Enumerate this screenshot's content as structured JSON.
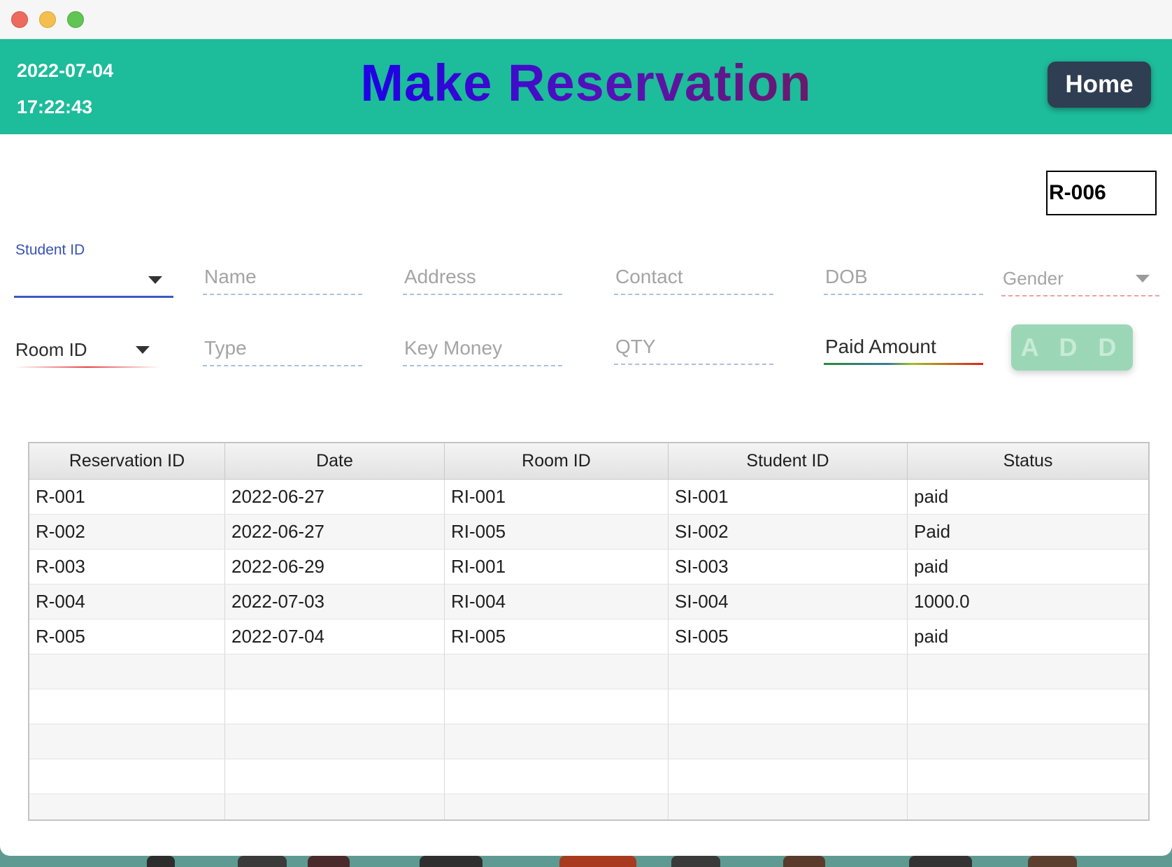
{
  "header": {
    "date": "2022-07-04",
    "time": "17:22:43",
    "title": "Make Reservation",
    "home_label": "Home",
    "colors": {
      "bar": "#1dbc9b",
      "title_start": "#1e00e6",
      "title_end": "#6a1a6a",
      "home_button": "#2f3e52"
    }
  },
  "reservation_id": "R-006",
  "form": {
    "student_id": {
      "label": "Student ID",
      "value": ""
    },
    "name": {
      "placeholder": "Name"
    },
    "address": {
      "placeholder": "Address"
    },
    "contact": {
      "placeholder": "Contact"
    },
    "dob": {
      "placeholder": "DOB"
    },
    "gender": {
      "placeholder": "Gender"
    },
    "room_id": {
      "placeholder": "Room ID"
    },
    "type": {
      "placeholder": "Type"
    },
    "key_money": {
      "placeholder": "Key Money"
    },
    "qty": {
      "placeholder": "QTY"
    },
    "paid_amount": {
      "placeholder": "Paid Amount"
    },
    "add_label": "A D D"
  },
  "table": {
    "columns": [
      "Reservation ID",
      "Date",
      "Room ID",
      "Student ID",
      "Status"
    ],
    "rows": [
      [
        "R-001",
        "2022-06-27",
        "RI-001",
        "SI-001",
        "paid"
      ],
      [
        "R-002",
        "2022-06-27",
        "RI-005",
        "SI-002",
        "Paid"
      ],
      [
        "R-003",
        "2022-06-29",
        "RI-001",
        "SI-003",
        "paid"
      ],
      [
        "R-004",
        "2022-07-03",
        "RI-004",
        "SI-004",
        "1000.0"
      ],
      [
        "R-005",
        "2022-07-04",
        "RI-005",
        "SI-005",
        "paid"
      ]
    ]
  }
}
